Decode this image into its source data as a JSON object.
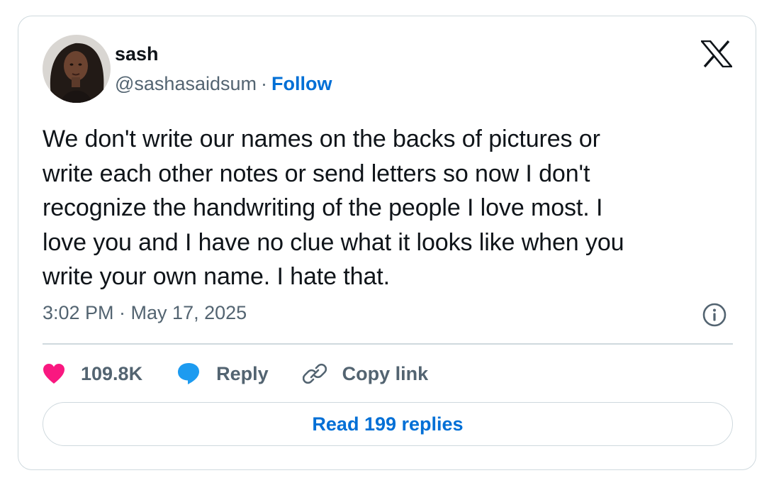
{
  "author": {
    "display_name": "sash",
    "handle": "@sashasaidsum",
    "separator": "·",
    "follow_label": "Follow"
  },
  "tweet": {
    "text": "We don't write our names on the backs of pictures or\nwrite each other notes or send letters so now I don't\nrecognize the handwriting of the people I love most. I\nlove you and I have no clue what it looks like when you\nwrite your own name. I hate that.",
    "timestamp": "3:02 PM · May 17, 2025"
  },
  "actions": {
    "likes": "109.8K",
    "reply_label": "Reply",
    "copy_link_label": "Copy link"
  },
  "read_replies_label": "Read 199 replies",
  "icons": {
    "brand": "x-logo-icon",
    "info": "info-icon",
    "like": "heart-icon",
    "reply": "speech-bubble-icon",
    "copy": "link-icon"
  },
  "colors": {
    "text": "#0f1419",
    "secondary": "#536471",
    "link": "#006fd6",
    "heart": "#f91880",
    "bubble": "#1d9bf0",
    "border": "#cfd9de"
  }
}
